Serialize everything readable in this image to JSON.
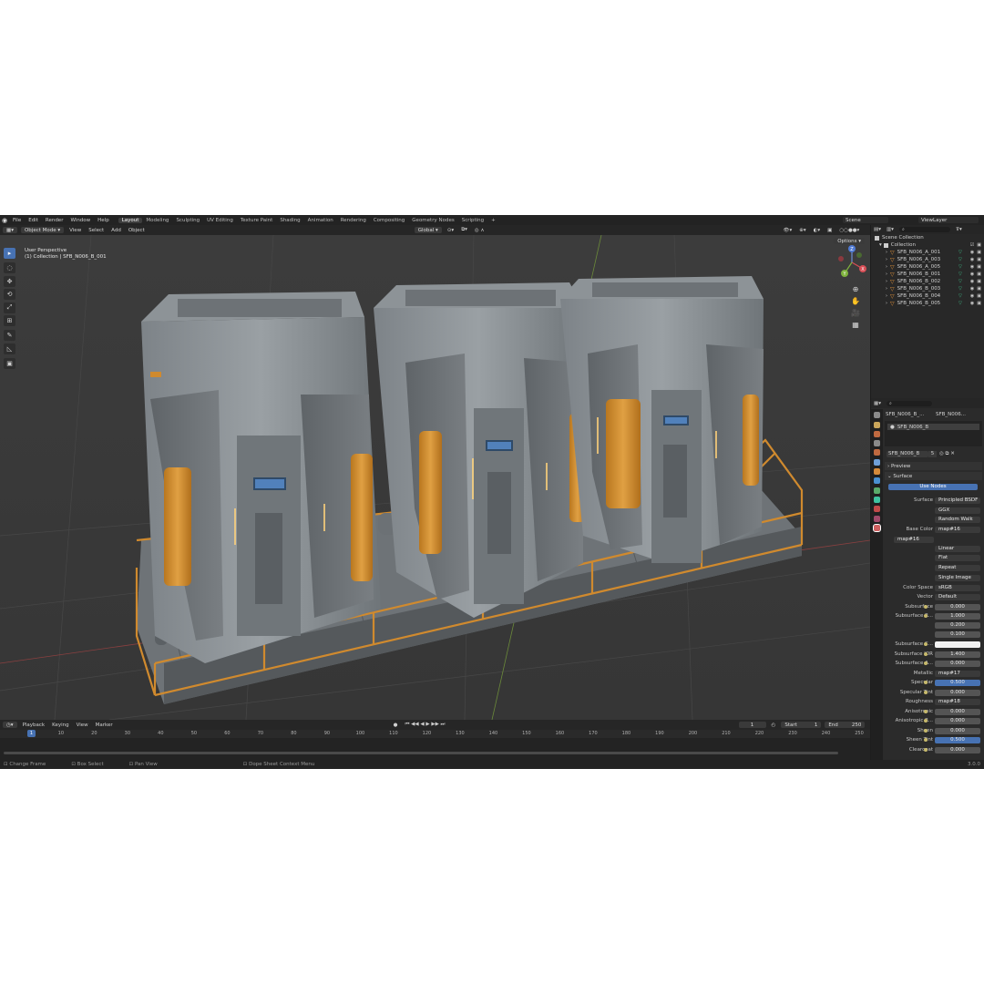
{
  "menu": [
    "File",
    "Edit",
    "Render",
    "Window",
    "Help"
  ],
  "workspaces": [
    "Layout",
    "Modeling",
    "Sculpting",
    "UV Editing",
    "Texture Paint",
    "Shading",
    "Animation",
    "Rendering",
    "Compositing",
    "Geometry Nodes",
    "Scripting",
    "+"
  ],
  "active_workspace": "Layout",
  "scene": "Scene",
  "view_layer": "ViewLayer",
  "viewport_header": {
    "mode": "Object Mode",
    "items": [
      "View",
      "Select",
      "Add",
      "Object"
    ],
    "transform": "Global",
    "options": "Options"
  },
  "viewport": {
    "line1": "User Perspective",
    "line2": "(1) Collection | SFB_N006_B_001"
  },
  "tools": [
    "▸",
    "◌",
    "✥",
    "⟲",
    "⤢",
    "⊞",
    "✎",
    "◺",
    "▣"
  ],
  "nav_icons": [
    "⊕",
    "✋",
    "🎥",
    "▦"
  ],
  "gizmo": {
    "x": "X",
    "y": "Y",
    "z": "Z"
  },
  "outliner": {
    "root": "Scene Collection",
    "collection": "Collection",
    "items": [
      "SFB_N006_A_001",
      "SFB_N006_A_003",
      "SFB_N006_A_005",
      "SFB_N006_B_001",
      "SFB_N006_B_002",
      "SFB_N006_B_003",
      "SFB_N006_B_004",
      "SFB_N006_B_005"
    ]
  },
  "properties": {
    "breadcrumb_a": "SFB_N006_B_...",
    "breadcrumb_b": "SFB_N006...",
    "slot": "SFB_N006_B",
    "material": "SFB_N006_B",
    "users": "5",
    "preview": "Preview",
    "surface_section": "Surface",
    "use_nodes": "Use Nodes",
    "rows": [
      {
        "label": "Surface",
        "value": "Principled BSDF",
        "kind": "dark"
      },
      {
        "label": "",
        "value": "GGX",
        "kind": "dark"
      },
      {
        "label": "",
        "value": "Random Walk",
        "kind": "dark"
      },
      {
        "label": "Base Color",
        "value": "map#16",
        "kind": "dark"
      },
      {
        "label": "",
        "value": "map#16",
        "kind": "dark"
      },
      {
        "label": "",
        "value": "Linear",
        "kind": "dark"
      },
      {
        "label": "",
        "value": "Flat",
        "kind": "dark"
      },
      {
        "label": "",
        "value": "Repeat",
        "kind": "dark"
      },
      {
        "label": "",
        "value": "Single Image",
        "kind": "dark"
      },
      {
        "label": "Color Space",
        "value": "sRGB",
        "kind": "dark"
      },
      {
        "label": "Vector",
        "value": "Default",
        "kind": "dark"
      },
      {
        "label": "Subsurface",
        "value": "0.000",
        "kind": "num"
      },
      {
        "label": "Subsurface R...",
        "value": "1.000",
        "kind": "num"
      },
      {
        "label": "",
        "value": "0.200",
        "kind": "num"
      },
      {
        "label": "",
        "value": "0.100",
        "kind": "num"
      },
      {
        "label": "Subsurface C...",
        "value": "",
        "kind": "white"
      },
      {
        "label": "Subsurface IOR",
        "value": "1.400",
        "kind": "num"
      },
      {
        "label": "Subsurface A...",
        "value": "0.000",
        "kind": "num"
      },
      {
        "label": "Metallic",
        "value": "map#17",
        "kind": "dark"
      },
      {
        "label": "Specular",
        "value": "0.500",
        "kind": "blue"
      },
      {
        "label": "Specular Tint",
        "value": "0.000",
        "kind": "num"
      },
      {
        "label": "Roughness",
        "value": "map#18",
        "kind": "dark"
      },
      {
        "label": "Anisotropic",
        "value": "0.000",
        "kind": "num"
      },
      {
        "label": "Anisotropic R...",
        "value": "0.000",
        "kind": "num"
      },
      {
        "label": "Sheen",
        "value": "0.000",
        "kind": "num"
      },
      {
        "label": "Sheen Tint",
        "value": "0.500",
        "kind": "blue"
      },
      {
        "label": "Clearcoat",
        "value": "0.000",
        "kind": "num"
      }
    ]
  },
  "timeline": {
    "menus": [
      "Playback",
      "Keying",
      "View",
      "Marker"
    ],
    "current_frame": "1",
    "start_label": "Start",
    "start": "1",
    "end_label": "End",
    "end": "250",
    "ticks": [
      "1",
      "10",
      "20",
      "30",
      "40",
      "50",
      "60",
      "70",
      "80",
      "90",
      "100",
      "110",
      "120",
      "130",
      "140",
      "150",
      "160",
      "170",
      "180",
      "190",
      "200",
      "210",
      "220",
      "230",
      "240",
      "250"
    ],
    "transport": "⏮ ◀◀ ◀ ▶ ▶▶ ⏭"
  },
  "status": {
    "a": "Change Frame",
    "b": "Box Select",
    "c": "Pan View",
    "d": "Dope Sheet Context Menu",
    "version": "3.0.0"
  },
  "colors": {
    "accent": "#4772b3",
    "orange": "#d08a2e",
    "steel": "#8b9296"
  }
}
